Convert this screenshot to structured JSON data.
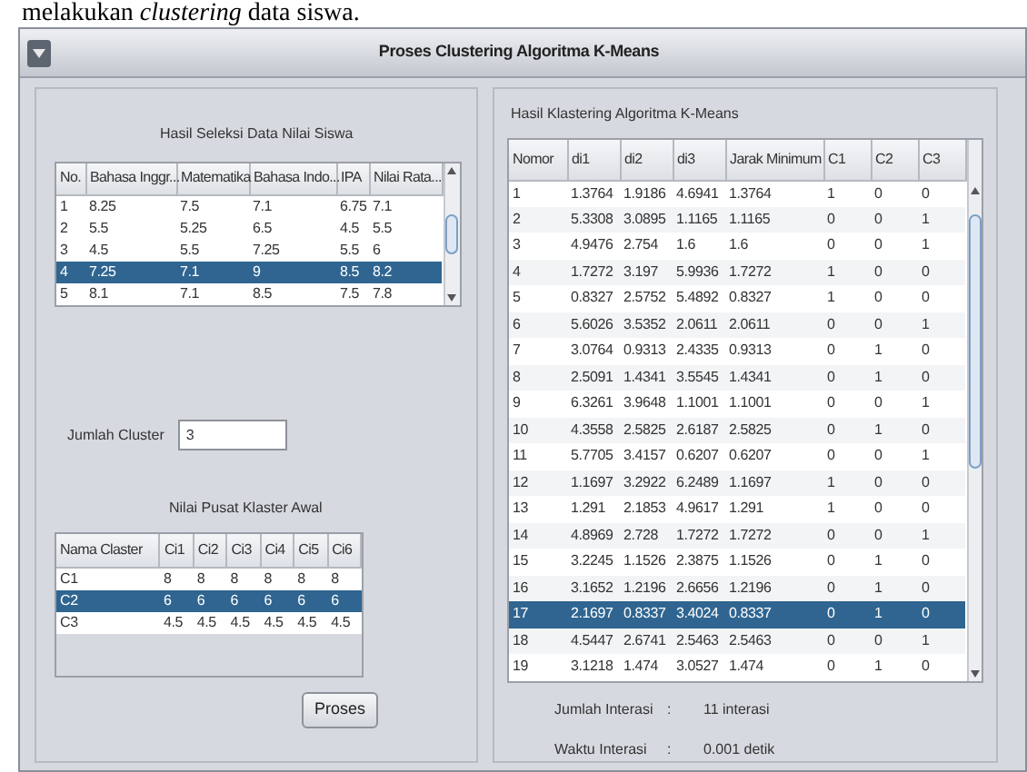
{
  "document_text": "melakukan *clustering* data siswa.",
  "window": {
    "title": "Proses Clustering Algoritma K-Means"
  },
  "left_panel": {
    "selection_table": {
      "title": "Hasil Seleksi Data Nilai Siswa",
      "columns": [
        "No.",
        "Bahasa Inggr...",
        "Matematika",
        "Bahasa Indo...",
        "IPA",
        "Nilai Rata..."
      ],
      "rows": [
        {
          "cells": [
            "1",
            "8.25",
            "7.5",
            "7.1",
            "6.75",
            "7.1"
          ],
          "selected": false
        },
        {
          "cells": [
            "2",
            "5.5",
            "5.25",
            "6.5",
            "4.5",
            "5.5"
          ],
          "selected": false
        },
        {
          "cells": [
            "3",
            "4.5",
            "5.5",
            "7.25",
            "5.5",
            "6"
          ],
          "selected": false
        },
        {
          "cells": [
            "4",
            "7.25",
            "7.1",
            "9",
            "8.5",
            "8.2"
          ],
          "selected": true
        },
        {
          "cells": [
            "5",
            "8.1",
            "7.1",
            "8.5",
            "7.5",
            "7.8"
          ],
          "selected": false
        }
      ]
    },
    "cluster_count": {
      "label": "Jumlah Cluster",
      "value": "3"
    },
    "centroid_table": {
      "title": "Nilai Pusat Klaster Awal",
      "columns": [
        "Nama Claster",
        "Ci1",
        "Ci2",
        "Ci3",
        "Ci4",
        "Ci5",
        "Ci6"
      ],
      "rows": [
        {
          "cells": [
            "C1",
            "8",
            "8",
            "8",
            "8",
            "8",
            "8"
          ],
          "selected": false
        },
        {
          "cells": [
            "C2",
            "6",
            "6",
            "6",
            "6",
            "6",
            "6"
          ],
          "selected": true
        },
        {
          "cells": [
            "C3",
            "4.5",
            "4.5",
            "4.5",
            "4.5",
            "4.5",
            "4.5"
          ],
          "selected": false
        }
      ]
    },
    "process_button": "Proses"
  },
  "right_panel": {
    "result_table": {
      "title": "Hasil Klastering Algoritma K-Means",
      "columns": [
        "Nomor",
        "di1",
        "di2",
        "di3",
        "Jarak Minimum",
        "C1",
        "C2",
        "C3"
      ],
      "rows": [
        {
          "cells": [
            "1",
            "1.3764",
            "1.9186",
            "4.6941",
            "1.3764",
            "1",
            "0",
            "0"
          ],
          "selected": false
        },
        {
          "cells": [
            "2",
            "5.3308",
            "3.0895",
            "1.1165",
            "1.1165",
            "0",
            "0",
            "1"
          ],
          "selected": false
        },
        {
          "cells": [
            "3",
            "4.9476",
            "2.754",
            "1.6",
            "1.6",
            "0",
            "0",
            "1"
          ],
          "selected": false
        },
        {
          "cells": [
            "4",
            "1.7272",
            "3.197",
            "5.9936",
            "1.7272",
            "1",
            "0",
            "0"
          ],
          "selected": false
        },
        {
          "cells": [
            "5",
            "0.8327",
            "2.5752",
            "5.4892",
            "0.8327",
            "1",
            "0",
            "0"
          ],
          "selected": false
        },
        {
          "cells": [
            "6",
            "5.6026",
            "3.5352",
            "2.0611",
            "2.0611",
            "0",
            "0",
            "1"
          ],
          "selected": false
        },
        {
          "cells": [
            "7",
            "3.0764",
            "0.9313",
            "2.4335",
            "0.9313",
            "0",
            "1",
            "0"
          ],
          "selected": false
        },
        {
          "cells": [
            "8",
            "2.5091",
            "1.4341",
            "3.5545",
            "1.4341",
            "0",
            "1",
            "0"
          ],
          "selected": false
        },
        {
          "cells": [
            "9",
            "6.3261",
            "3.9648",
            "1.1001",
            "1.1001",
            "0",
            "0",
            "1"
          ],
          "selected": false
        },
        {
          "cells": [
            "10",
            "4.3558",
            "2.5825",
            "2.6187",
            "2.5825",
            "0",
            "1",
            "0"
          ],
          "selected": false
        },
        {
          "cells": [
            "11",
            "5.7705",
            "3.4157",
            "0.6207",
            "0.6207",
            "0",
            "0",
            "1"
          ],
          "selected": false
        },
        {
          "cells": [
            "12",
            "1.1697",
            "3.2922",
            "6.2489",
            "1.1697",
            "1",
            "0",
            "0"
          ],
          "selected": false
        },
        {
          "cells": [
            "13",
            "1.291",
            "2.1853",
            "4.9617",
            "1.291",
            "1",
            "0",
            "0"
          ],
          "selected": false
        },
        {
          "cells": [
            "14",
            "4.8969",
            "2.728",
            "1.7272",
            "1.7272",
            "0",
            "0",
            "1"
          ],
          "selected": false
        },
        {
          "cells": [
            "15",
            "3.2245",
            "1.1526",
            "2.3875",
            "1.1526",
            "0",
            "1",
            "0"
          ],
          "selected": false
        },
        {
          "cells": [
            "16",
            "3.1652",
            "1.2196",
            "2.6656",
            "1.2196",
            "0",
            "1",
            "0"
          ],
          "selected": false
        },
        {
          "cells": [
            "17",
            "2.1697",
            "0.8337",
            "3.4024",
            "0.8337",
            "0",
            "1",
            "0"
          ],
          "selected": true
        },
        {
          "cells": [
            "18",
            "4.5447",
            "2.6741",
            "2.5463",
            "2.5463",
            "0",
            "0",
            "1"
          ],
          "selected": false
        },
        {
          "cells": [
            "19",
            "3.1218",
            "1.474",
            "3.0527",
            "1.474",
            "0",
            "1",
            "0"
          ],
          "selected": false
        }
      ]
    },
    "stats": [
      {
        "label": "Jumlah Interasi",
        "separator": ":",
        "value": "11 interasi"
      },
      {
        "label": "Waktu Interasi",
        "separator": ":",
        "value": "0.001 detik"
      }
    ]
  }
}
